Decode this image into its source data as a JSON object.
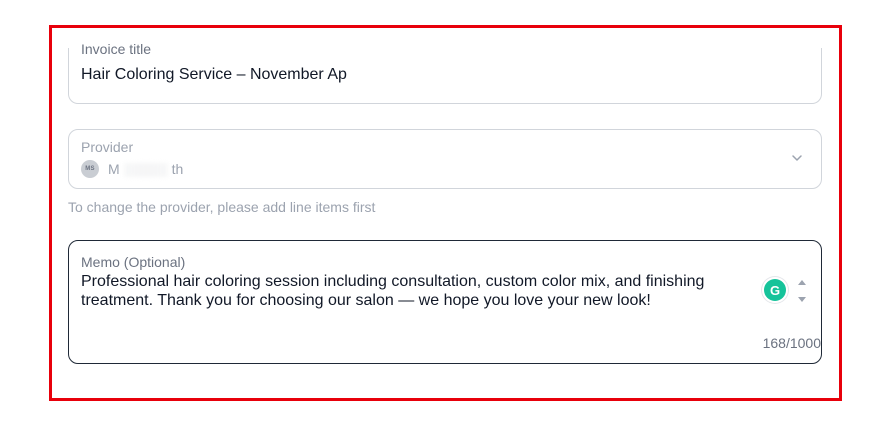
{
  "invoice": {
    "label": "Invoice title",
    "value": "Hair Coloring Service – November Ap"
  },
  "provider": {
    "label": "Provider",
    "avatar_initials": "MS",
    "name_start": "M",
    "name_end": "th",
    "helper_text": "To change the provider, please add line items first",
    "dropdown_icon": "chevron-down-icon"
  },
  "memo": {
    "label": "Memo (Optional)",
    "value": "Professional hair coloring session including consultation, custom color mix, and finishing treatment. Thank you for choosing our salon — we hope you love your new look!",
    "counter": "168/1000",
    "extension_icon": "grammarly-icon"
  },
  "colors": {
    "frame": "#e8000b",
    "grammarly": "#15c39a"
  }
}
